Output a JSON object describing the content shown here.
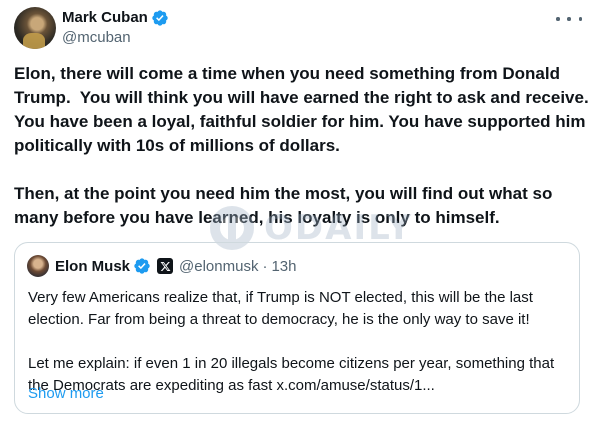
{
  "author": {
    "display_name": "Mark Cuban",
    "handle": "@mcuban"
  },
  "tweet": {
    "text": "Elon, there will come a time when you need something from Donald Trump.  You will think you will have earned the right to ask and receive.  You have been a loyal, faithful soldier for him. You have supported him politically with 10s of millions of dollars.\n\nThen, at the point you need him the most, you will find out what so many before you have learned, his loyalty is only to himself."
  },
  "watermark": {
    "text": "ODAILY"
  },
  "quoted_tweet": {
    "display_name": "Elon Musk",
    "handle": "@elonmusk",
    "separator": "·",
    "time": "13h",
    "text": "Very few Americans realize that, if Trump is NOT elected, this will be the last election. Far from being a threat to democracy, he is the only way to save it!\n\nLet me explain: if even 1 in 20 illegals become citizens per year, something that the Democrats are expediting as fast x.com/amuse/status/1...",
    "show_more_label": "Show more"
  },
  "colors": {
    "verified_blue": "#1d9bf0",
    "link_blue": "#1d9bf0",
    "muted_text": "#536471",
    "border": "#cfd9de"
  },
  "icons": {
    "verified": "verified-badge-icon",
    "more": "more-horizontal-icon",
    "affiliate": "x-logo-icon"
  }
}
